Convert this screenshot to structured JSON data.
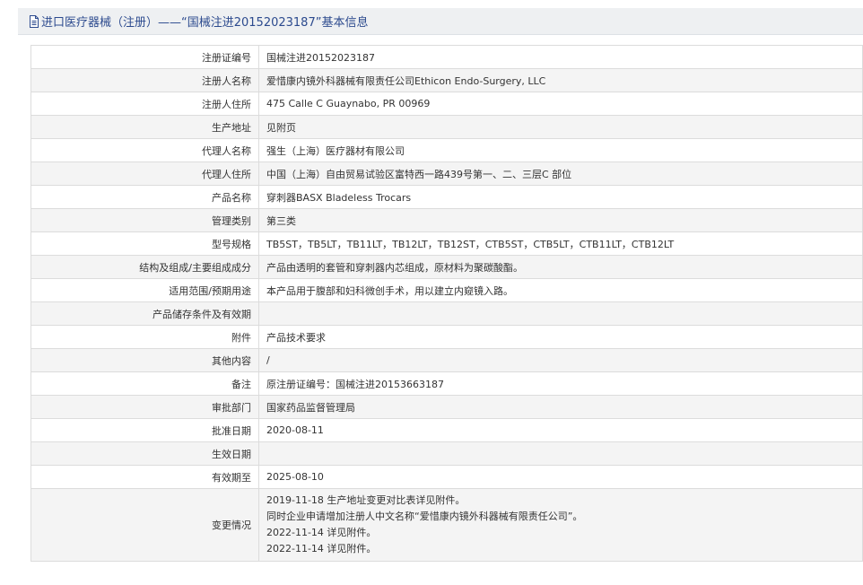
{
  "header": {
    "icon": "document-icon",
    "title": "进口医疗器械（注册）——“国械注进20152023187”基本信息"
  },
  "rows": [
    {
      "label": "注册证编号",
      "value": "国械注进20152023187"
    },
    {
      "label": "注册人名称",
      "value": "爱惜康内镜外科器械有限责任公司Ethicon Endo-Surgery, LLC"
    },
    {
      "label": "注册人住所",
      "value": "475 Calle C Guaynabo, PR 00969"
    },
    {
      "label": "生产地址",
      "value": "见附页"
    },
    {
      "label": "代理人名称",
      "value": "强生（上海）医疗器材有限公司"
    },
    {
      "label": "代理人住所",
      "value": "中国（上海）自由贸易试验区富特西一路439号第一、二、三层C 部位"
    },
    {
      "label": "产品名称",
      "value": "穿刺器BASX Bladeless Trocars"
    },
    {
      "label": "管理类别",
      "value": "第三类"
    },
    {
      "label": "型号规格",
      "value": "TB5ST，TB5LT，TB11LT，TB12LT，TB12ST，CTB5ST，CTB5LT，CTB11LT，CTB12LT"
    },
    {
      "label": "结构及组成/主要组成成分",
      "value": "产品由透明的套管和穿刺器内芯组成，原材料为聚碳酸酯。"
    },
    {
      "label": "适用范围/预期用途",
      "value": "本产品用于腹部和妇科微创手术，用以建立内窥镜入路。"
    },
    {
      "label": "产品储存条件及有效期",
      "value": ""
    },
    {
      "label": "附件",
      "value": "产品技术要求"
    },
    {
      "label": "其他内容",
      "value": "/"
    },
    {
      "label": "备注",
      "value": "原注册证编号：国械注进20153663187"
    },
    {
      "label": "审批部门",
      "value": "国家药品监督管理局"
    },
    {
      "label": "批准日期",
      "value": "2020-08-11"
    },
    {
      "label": "生效日期",
      "value": ""
    },
    {
      "label": "有效期至",
      "value": "2025-08-10"
    }
  ],
  "change_row": {
    "label": "变更情况",
    "lines": [
      "2019-11-18 生产地址变更对比表详见附件。",
      "同时企业申请增加注册人中文名称“爱惜康内镜外科器械有限责任公司”。",
      "2022-11-14 详见附件。",
      "2022-11-14 详见附件。"
    ]
  }
}
